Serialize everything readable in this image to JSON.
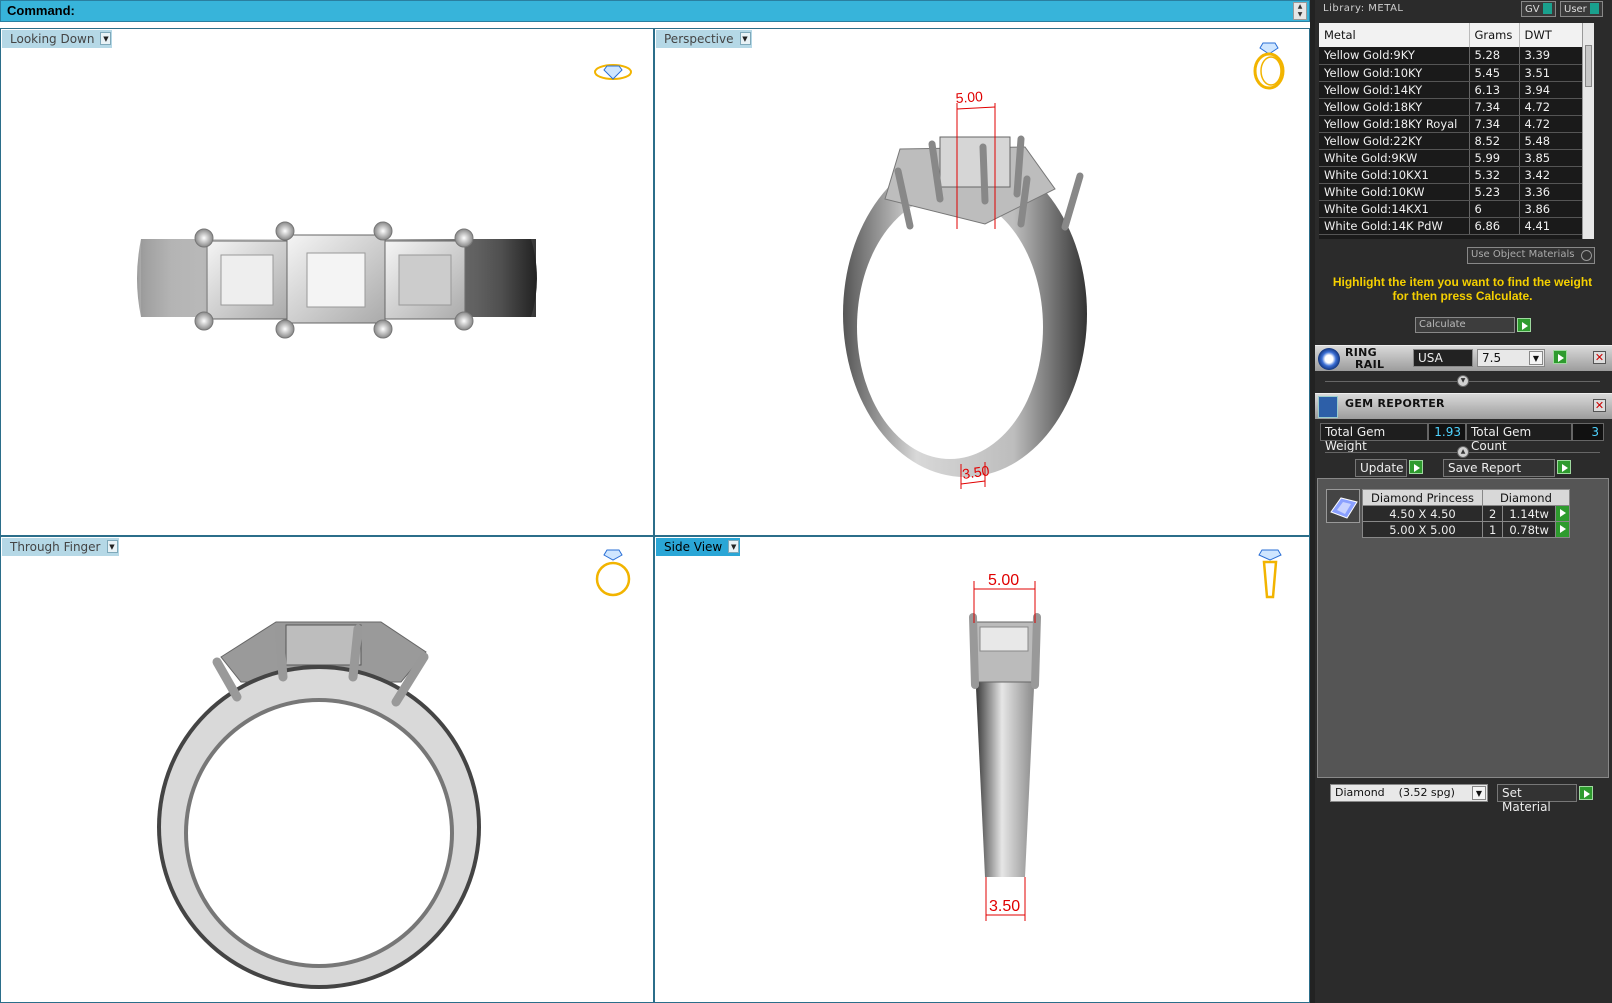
{
  "command": {
    "label": "Command:"
  },
  "viewports": {
    "top_left": {
      "label": "Looking Down",
      "active": false
    },
    "top_right": {
      "label": "Perspective",
      "active": false
    },
    "bottom_left": {
      "label": "Through Finger",
      "active": false
    },
    "bottom_right": {
      "label": "Side View",
      "active": true
    }
  },
  "dimensions": {
    "perspective_top": "5.00",
    "perspective_bottom": "3.50",
    "side_top": "5.00",
    "side_bottom": "3.50"
  },
  "library": {
    "title": "Library: METAL",
    "btn_gv": "GV",
    "btn_user": "User",
    "columns": [
      "Metal",
      "Grams",
      "DWT"
    ],
    "rows": [
      [
        "Yellow Gold:9KY",
        "5.28",
        "3.39"
      ],
      [
        "Yellow Gold:10KY",
        "5.45",
        "3.51"
      ],
      [
        "Yellow Gold:14KY",
        "6.13",
        "3.94"
      ],
      [
        "Yellow Gold:18KY",
        "7.34",
        "4.72"
      ],
      [
        "Yellow Gold:18KY Royal",
        "7.34",
        "4.72"
      ],
      [
        "Yellow Gold:22KY",
        "8.52",
        "5.48"
      ],
      [
        "White Gold:9KW",
        "5.99",
        "3.85"
      ],
      [
        "White Gold:10KX1",
        "5.32",
        "3.42"
      ],
      [
        "White Gold:10KW",
        "5.23",
        "3.36"
      ],
      [
        "White Gold:14KX1",
        "6",
        "3.86"
      ],
      [
        "White Gold:14K PdW",
        "6.86",
        "4.41"
      ]
    ],
    "use_object_materials": "Use Object Materials",
    "hint": "Highlight the item you want to find the weight for then press Calculate.",
    "calculate": "Calculate"
  },
  "ring_rail": {
    "title_line1": "RING",
    "title_line2": "RAIL",
    "standard": "USA",
    "size": "7.5"
  },
  "gem_reporter": {
    "title": "GEM REPORTER",
    "total_weight_label": "Total Gem Weight",
    "total_weight_value": "1.93",
    "total_count_label": "Total Gem Count",
    "total_count_value": "3",
    "update": "Update",
    "save_report": "Save Report",
    "group": {
      "shape": "Diamond Princess",
      "material": "Diamond"
    },
    "stones": [
      {
        "size": "4.50 X 4.50",
        "count": "2",
        "weight": "1.14tw"
      },
      {
        "size": "5.00 X 5.00",
        "count": "1",
        "weight": "0.78tw"
      }
    ],
    "material_select": "Diamond    (3.52 spg)",
    "set_material": "Set Material"
  },
  "colors": {
    "accent": "#37b4da",
    "hint": "#f5d000",
    "green_button": "#2e9b2e",
    "dimension": "#e00000",
    "gizmo_gold": "#f2b400"
  }
}
